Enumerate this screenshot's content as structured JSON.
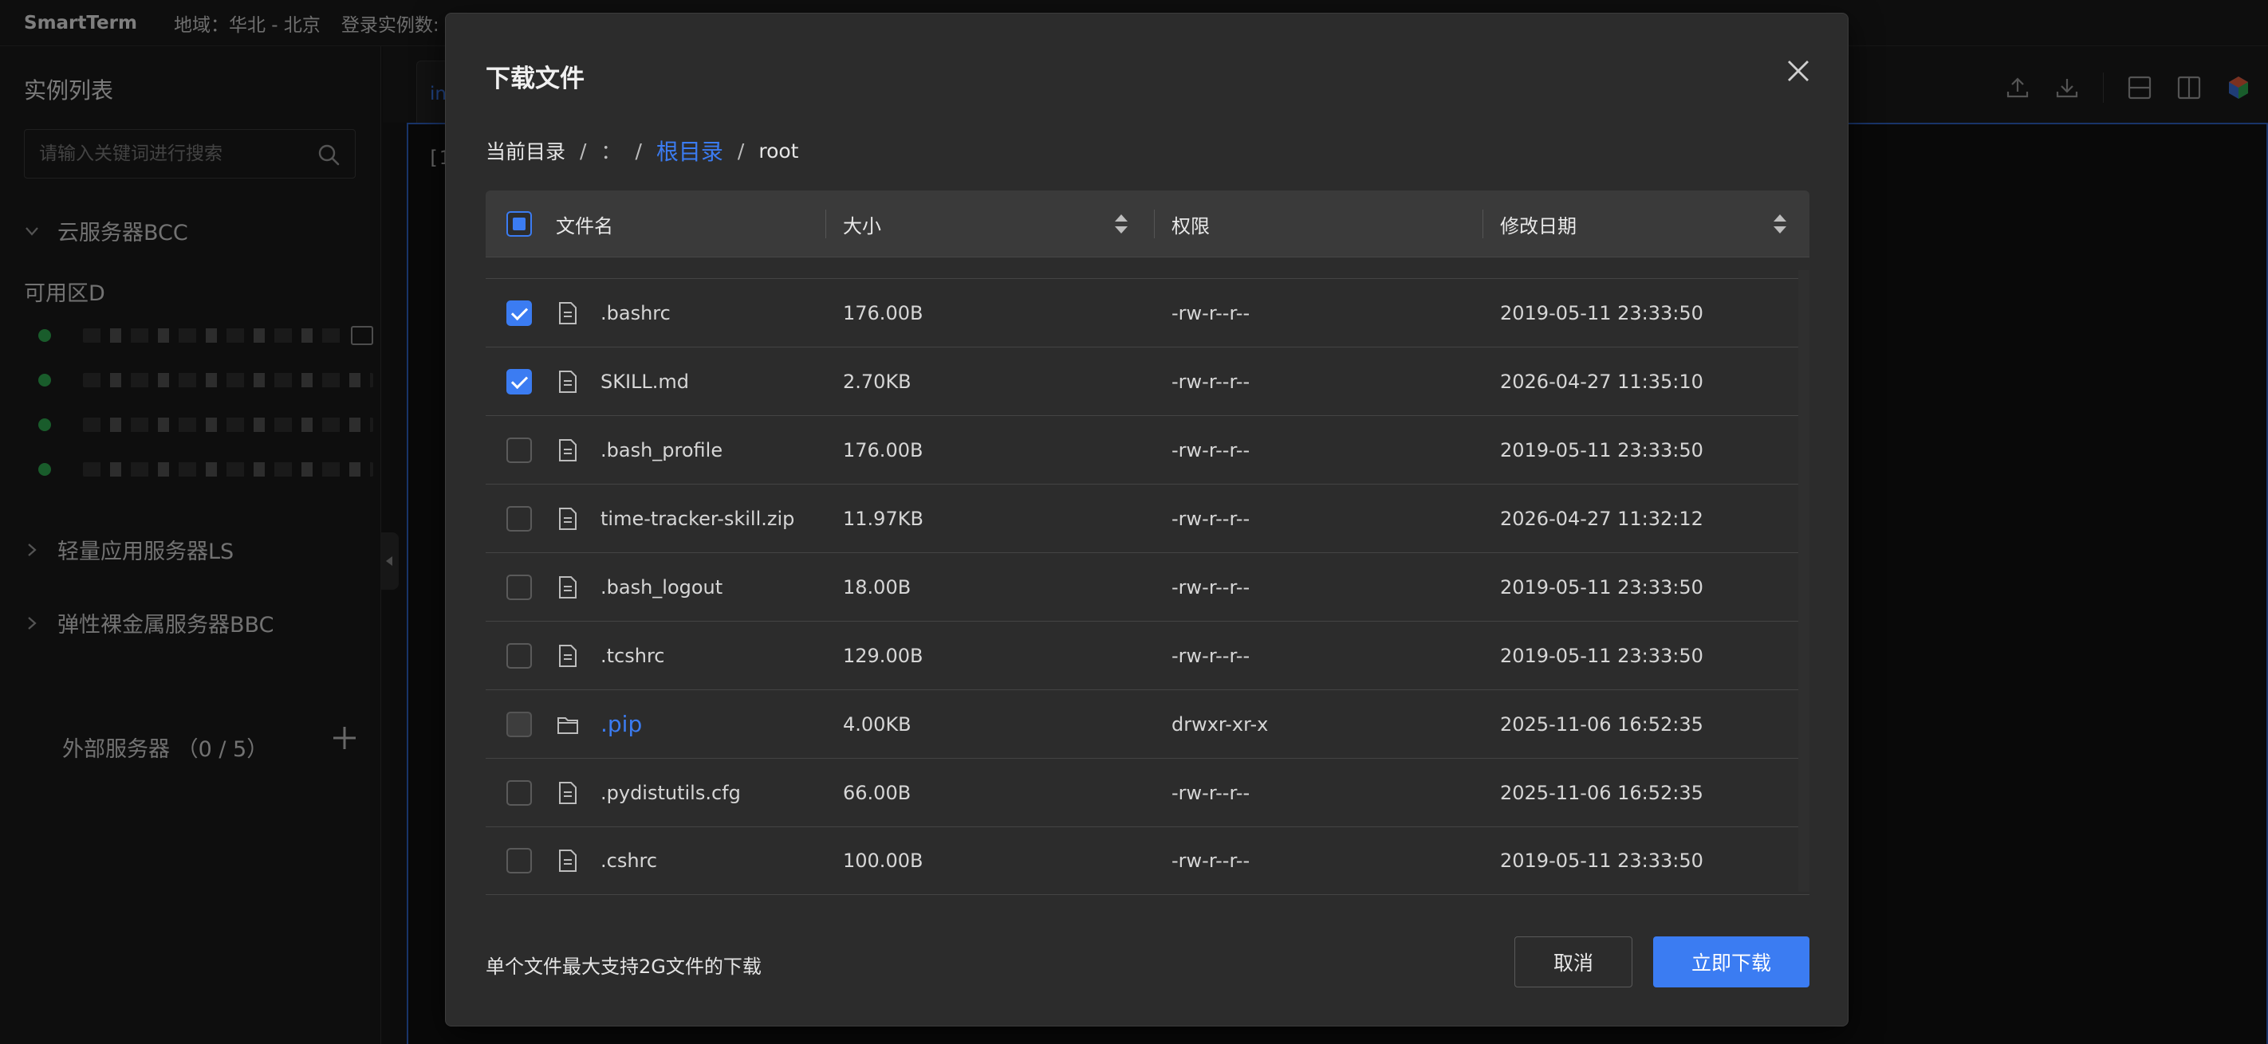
{
  "topbar": {
    "brand": "SmartTerm",
    "region": "地域：华北 - 北京",
    "login_count": "登录实例数:"
  },
  "sidebar": {
    "title": "实例列表",
    "search_placeholder": "请输入关键词进行搜索",
    "groups": [
      {
        "label": "云服务器BCC",
        "expanded": true
      },
      {
        "label": "轻量应用服务器LS",
        "expanded": false
      },
      {
        "label": "弹性裸金属服务器BBC",
        "expanded": false
      }
    ],
    "zone": "可用区D",
    "instance_count_visible": 4,
    "external": "外部服务器 （0 / 5）"
  },
  "workspace": {
    "tab_label": "in",
    "prompt": "[1"
  },
  "modal": {
    "title": "下载文件",
    "breadcrumb": {
      "label": "当前目录",
      "sep": "/",
      "colon": "：",
      "root_link": "根目录",
      "current": "root"
    },
    "columns": {
      "name": "文件名",
      "size": "大小",
      "perm": "权限",
      "date": "修改日期"
    },
    "files": [
      {
        "name": ".bashrc",
        "size": "176.00B",
        "perm": "-rw-r--r--",
        "date": "2019-05-11 23:33:50",
        "checked": true,
        "type": "file"
      },
      {
        "name": "SKILL.md",
        "size": "2.70KB",
        "perm": "-rw-r--r--",
        "date": "2026-04-27 11:35:10",
        "checked": true,
        "type": "file"
      },
      {
        "name": ".bash_profile",
        "size": "176.00B",
        "perm": "-rw-r--r--",
        "date": "2019-05-11 23:33:50",
        "checked": false,
        "type": "file"
      },
      {
        "name": "time-tracker-skill.zip",
        "size": "11.97KB",
        "perm": "-rw-r--r--",
        "date": "2026-04-27 11:32:12",
        "checked": false,
        "type": "file"
      },
      {
        "name": ".bash_logout",
        "size": "18.00B",
        "perm": "-rw-r--r--",
        "date": "2019-05-11 23:33:50",
        "checked": false,
        "type": "file"
      },
      {
        "name": ".tcshrc",
        "size": "129.00B",
        "perm": "-rw-r--r--",
        "date": "2019-05-11 23:33:50",
        "checked": false,
        "type": "file"
      },
      {
        "name": ".pip",
        "size": "4.00KB",
        "perm": "drwxr-xr-x",
        "date": "2025-11-06 16:52:35",
        "checked": false,
        "type": "folder"
      },
      {
        "name": ".pydistutils.cfg",
        "size": "66.00B",
        "perm": "-rw-r--r--",
        "date": "2025-11-06 16:52:35",
        "checked": false,
        "type": "file"
      },
      {
        "name": ".cshrc",
        "size": "100.00B",
        "perm": "-rw-r--r--",
        "date": "2019-05-11 23:33:50",
        "checked": false,
        "type": "file"
      }
    ],
    "footer_note": "单个文件最大支持2G文件的下载",
    "cancel_label": "取消",
    "ok_label": "立即下载"
  },
  "colors": {
    "accent": "#3b7cf2",
    "online": "#2fa84f"
  }
}
